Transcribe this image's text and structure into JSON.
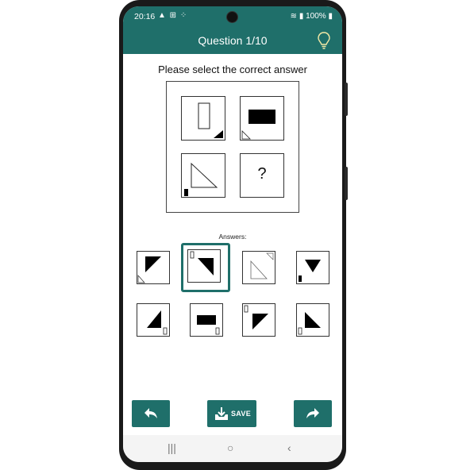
{
  "status_bar": {
    "time": "20:16",
    "left_icons": "▲ ⊞ ⁘",
    "right_text": "100%",
    "right_icons": "wifi-icon signal-icon battery-icon"
  },
  "app_bar": {
    "title": "Question 1/10",
    "hint_icon": "lightbulb-icon",
    "background": "#1f6f6a"
  },
  "prompt": "Please select the correct answer",
  "puzzle": {
    "tiles": [
      {
        "id": "tile-1",
        "content": "tall-rectangle-outline with small black triangle bottom-right"
      },
      {
        "id": "tile-2",
        "content": "wide black rectangle with small outline triangle bottom-left"
      },
      {
        "id": "tile-3",
        "content": "outline triangle with small black rectangle bottom-left"
      },
      {
        "id": "tile-4",
        "content": "?"
      }
    ],
    "unknown_mark": "?"
  },
  "answers_label": "Answers:",
  "answers": [
    {
      "index": 1,
      "selected": false
    },
    {
      "index": 2,
      "selected": true
    },
    {
      "index": 3,
      "selected": false
    },
    {
      "index": 4,
      "selected": false
    },
    {
      "index": 5,
      "selected": false
    },
    {
      "index": 6,
      "selected": false
    },
    {
      "index": 7,
      "selected": false
    },
    {
      "index": 8,
      "selected": false
    }
  ],
  "actions": {
    "back_icon": "reply-arrow-icon",
    "save_label": "SAVE",
    "save_icon": "download-tray-icon",
    "forward_icon": "share-arrow-icon"
  },
  "system_nav": {
    "recents": "|||",
    "home": "○",
    "back": "‹"
  }
}
